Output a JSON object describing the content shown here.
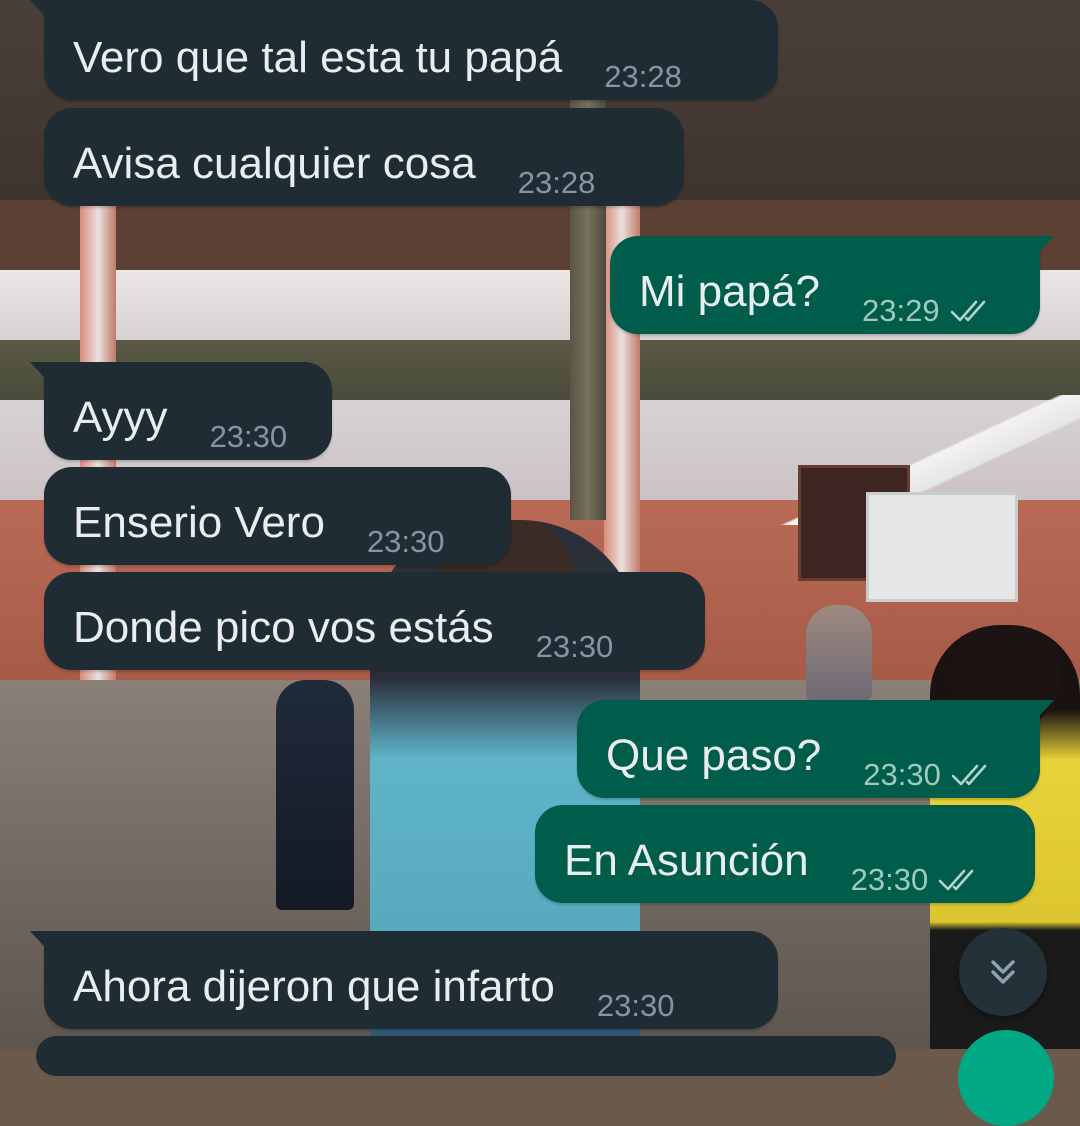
{
  "messages": [
    {
      "id": "m1",
      "direction": "incoming",
      "text": "Vero que tal esta tu papá",
      "time": "23:28"
    },
    {
      "id": "m2",
      "direction": "incoming",
      "text": "Avisa cualquier cosa",
      "time": "23:28"
    },
    {
      "id": "m3",
      "direction": "outgoing",
      "text": "Mi papá?",
      "time": "23:29",
      "status": "read-ticks-icon"
    },
    {
      "id": "m4",
      "direction": "incoming",
      "text": "Ayyy",
      "time": "23:30"
    },
    {
      "id": "m5",
      "direction": "incoming",
      "text": "Enserio Vero",
      "time": "23:30"
    },
    {
      "id": "m6",
      "direction": "incoming",
      "text": "Donde pico vos estás",
      "time": "23:30"
    },
    {
      "id": "m7",
      "direction": "outgoing",
      "text": "Que paso?",
      "time": "23:30",
      "status": "read-ticks-icon"
    },
    {
      "id": "m8",
      "direction": "outgoing",
      "text": "En Asunción",
      "time": "23:30",
      "status": "read-ticks-icon"
    },
    {
      "id": "m9",
      "direction": "incoming",
      "text": "Ahora dijeron que infarto",
      "time": "23:30"
    }
  ],
  "controls": {
    "scroll_down_icon": "double-chevron-down-icon"
  },
  "colors": {
    "incoming_bubble": "#1f2c34",
    "outgoing_bubble": "#005c4b",
    "message_text": "#e9edef",
    "time_text": "#8696a0",
    "read_ticks": "#b5d3cb",
    "fab": "#00a884"
  }
}
